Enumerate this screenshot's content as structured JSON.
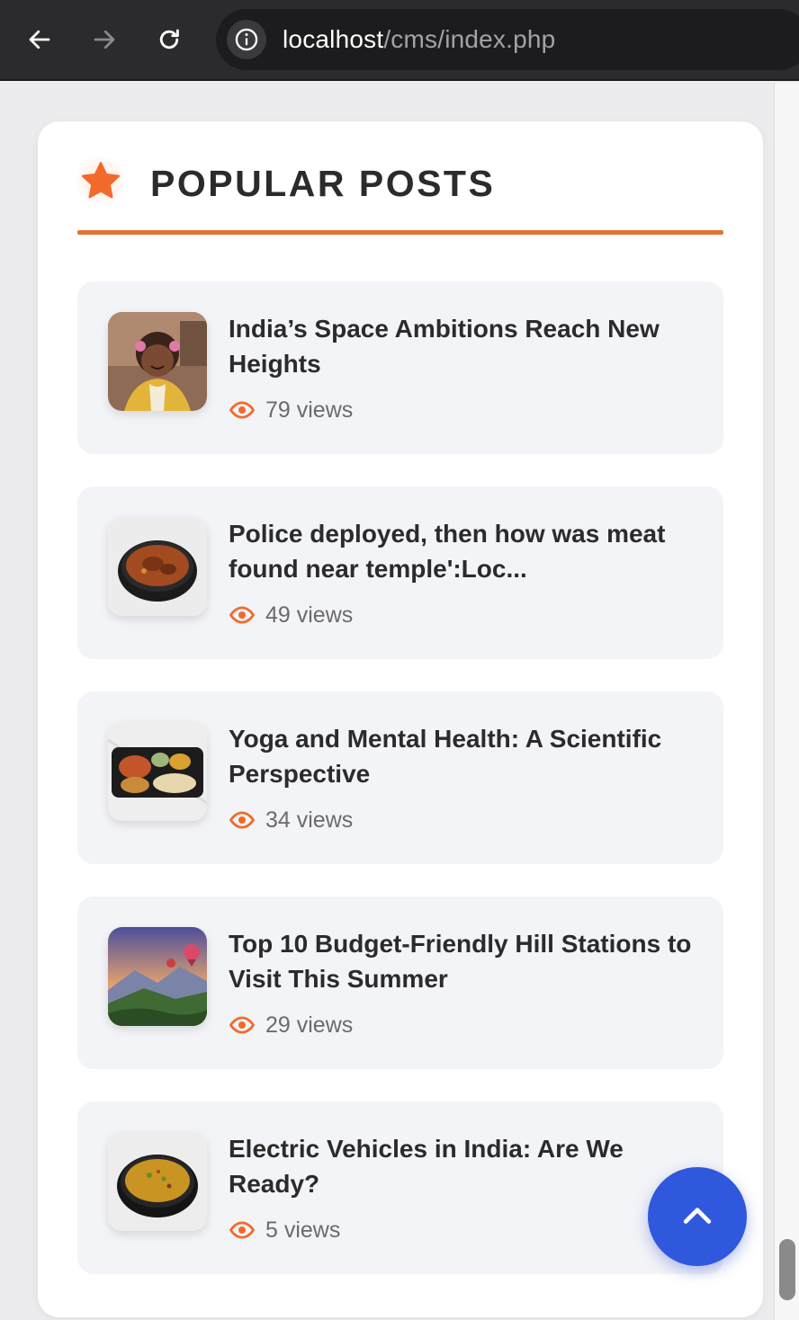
{
  "browser": {
    "url_host": "localhost",
    "url_path": "/cms/index.php",
    "back_icon": "arrow-left-icon",
    "forward_icon": "arrow-right-icon",
    "reload_icon": "reload-icon",
    "info_icon": "info-icon"
  },
  "widget": {
    "title": "POPULAR POSTS",
    "title_icon": "star-icon",
    "accent_color": "#e37333"
  },
  "posts": [
    {
      "title": "India’s Space Ambitions Reach New Heights",
      "views": "79 views",
      "thumbnail": "girl-portrait"
    },
    {
      "title": "Police deployed, then how was meat found near temple':Loc...",
      "views": "49 views",
      "thumbnail": "curry-bowl"
    },
    {
      "title": "Yoga and Mental Health: A Scientific Perspective",
      "views": "34 views",
      "thumbnail": "thali-tray"
    },
    {
      "title": "Top 10 Budget-Friendly Hill Stations to Visit This Summer",
      "views": "29 views",
      "thumbnail": "hills-balloons"
    },
    {
      "title": "Electric Vehicles in India: Are We Ready?",
      "views": "5 views",
      "thumbnail": "dal-bowl"
    }
  ],
  "scroll_top_button": {
    "icon": "chevron-up-icon",
    "color": "#2f58dd"
  }
}
